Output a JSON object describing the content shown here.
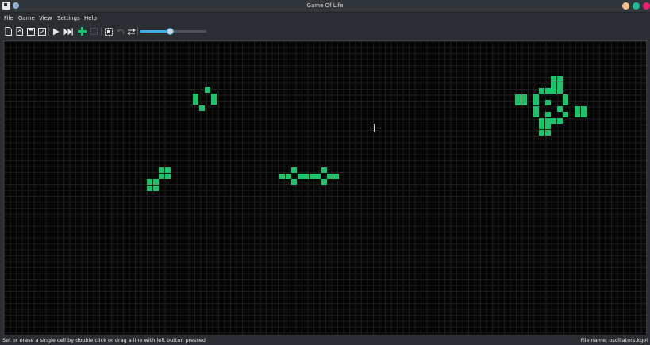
{
  "window": {
    "title": "Game Of Life",
    "controls": [
      {
        "name": "minimize",
        "color": "#f5c28b"
      },
      {
        "name": "maximize",
        "color": "#1abc9c"
      },
      {
        "name": "close",
        "color": "#ed1e6f"
      }
    ]
  },
  "menu": [
    "File",
    "Game",
    "View",
    "Settings",
    "Help"
  ],
  "toolbar": {
    "icons": [
      "new-icon",
      "open-icon",
      "save-icon",
      "save-as-icon",
      "play-icon",
      "fast-forward-icon",
      "add-cell-icon",
      "select-icon",
      "zoom-fit-icon",
      "undo-icon",
      "swap-icon"
    ],
    "speed": 0.45
  },
  "board": {
    "cell_color": "#19c46a",
    "background": "#050505"
  },
  "status": {
    "hint": "Set or erase a single cell by double click or drag a line with left button pressed",
    "file": "File name: oscillators.kgol"
  }
}
